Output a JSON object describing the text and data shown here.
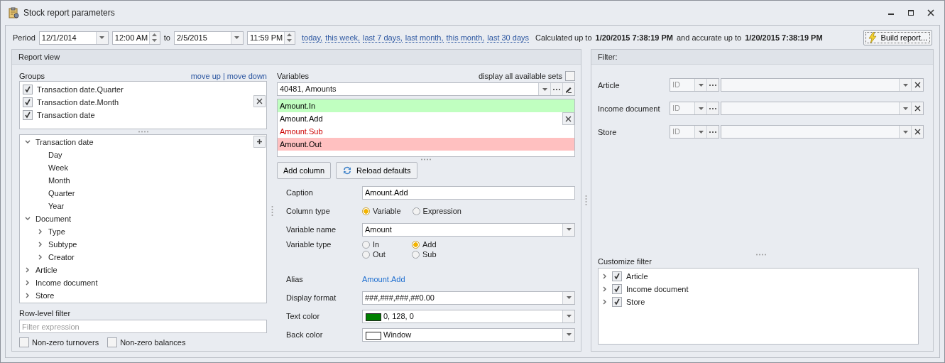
{
  "window": {
    "title": "Stock report parameters"
  },
  "period": {
    "label": "Period",
    "from_date": "12/1/2014",
    "from_time": "12:00 AM",
    "to_label": "to",
    "to_date": "2/5/2015",
    "to_time": "11:59 PM",
    "presets": [
      "today,",
      "this week,",
      "last 7 days,",
      "last month,",
      "this month,",
      "last 30 days"
    ],
    "calculated_label": "Calculated up to",
    "calculated_value": "1/20/2015 7:38:19 PM",
    "accurate_label": "and accurate up to",
    "accurate_value": "1/20/2015 7:38:19 PM",
    "build_button": "Build report..."
  },
  "report_view": {
    "title": "Report view",
    "groups": {
      "label": "Groups",
      "move_up": "move up",
      "separator": "|",
      "move_down": "move down",
      "items": [
        {
          "label": "Transaction date.Quarter",
          "checked": true
        },
        {
          "label": "Transaction date.Month",
          "checked": true
        },
        {
          "label": "Transaction date",
          "checked": true
        }
      ]
    },
    "tree": [
      {
        "label": "Transaction date",
        "expanded": true,
        "children": [
          {
            "label": "Day"
          },
          {
            "label": "Week"
          },
          {
            "label": "Month"
          },
          {
            "label": "Quarter"
          },
          {
            "label": "Year"
          }
        ]
      },
      {
        "label": "Document",
        "expanded": true,
        "children": [
          {
            "label": "Type",
            "expanded": false
          },
          {
            "label": "Subtype",
            "expanded": false
          },
          {
            "label": "Creator",
            "expanded": false
          }
        ]
      },
      {
        "label": "Article",
        "expanded": false
      },
      {
        "label": "Income document",
        "expanded": false
      },
      {
        "label": "Store",
        "expanded": false
      }
    ],
    "row_filter": {
      "label": "Row-level filter",
      "placeholder": "Filter expression"
    },
    "options": [
      {
        "label": "Non-zero turnovers",
        "checked": false
      },
      {
        "label": "Non-zero balances",
        "checked": false
      }
    ]
  },
  "variables": {
    "label": "Variables",
    "display_all_label": "display all available sets",
    "display_all_checked": false,
    "set_value": "40481, Amounts",
    "items": [
      {
        "label": "Amount.In",
        "kind": "in",
        "selected": false
      },
      {
        "label": "Amount.Add",
        "kind": "add",
        "selected": true
      },
      {
        "label": "Amount.Sub",
        "kind": "sub",
        "selected": false
      },
      {
        "label": "Amount.Out",
        "kind": "out",
        "selected": false
      }
    ],
    "add_column": "Add column",
    "reload_defaults": "Reload defaults"
  },
  "column": {
    "caption": {
      "label": "Caption",
      "value": "Amount.Add"
    },
    "column_type": {
      "label": "Column type",
      "options": [
        {
          "label": "Variable",
          "selected": true
        },
        {
          "label": "Expression",
          "selected": false
        }
      ]
    },
    "variable_name": {
      "label": "Variable name",
      "value": "Amount"
    },
    "variable_type": {
      "label": "Variable type",
      "options": [
        {
          "label": "In",
          "selected": false
        },
        {
          "label": "Add",
          "selected": true
        },
        {
          "label": "Out",
          "selected": false
        },
        {
          "label": "Sub",
          "selected": false
        }
      ]
    },
    "alias": {
      "label": "Alias",
      "value": "Amount.Add"
    },
    "display_format": {
      "label": "Display format",
      "value": "###,###,###,##0.00"
    },
    "text_color": {
      "label": "Text color",
      "color": "#008000",
      "value": "0, 128, 0"
    },
    "back_color": {
      "label": "Back color",
      "color": "#ffffff",
      "value": "Window"
    }
  },
  "filter": {
    "title": "Filter:",
    "rows": [
      {
        "label": "Article",
        "id_placeholder": "ID"
      },
      {
        "label": "Income document",
        "id_placeholder": "ID"
      },
      {
        "label": "Store",
        "id_placeholder": "ID"
      }
    ],
    "customize_label": "Customize filter",
    "customize_items": [
      {
        "label": "Article",
        "checked": true,
        "expanded": false
      },
      {
        "label": "Income document",
        "checked": true,
        "expanded": false
      },
      {
        "label": "Store",
        "checked": true,
        "expanded": false
      }
    ]
  }
}
